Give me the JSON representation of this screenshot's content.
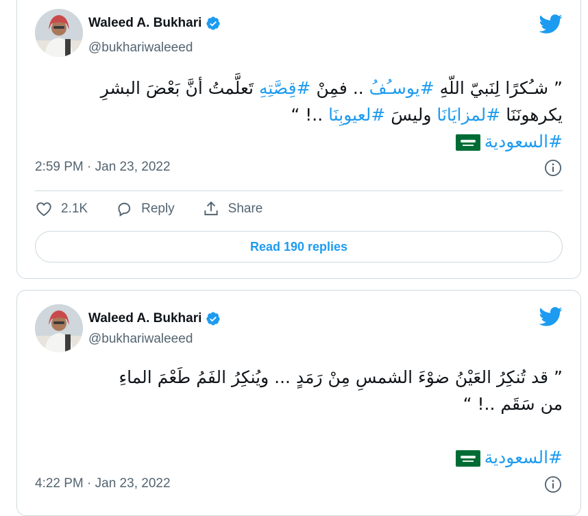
{
  "tweets": [
    {
      "author": {
        "name": "Waleed A. Bukhari",
        "handle": "@bukhariwaleeed"
      },
      "text_lines": [
        [
          {
            "t": "” شـُكرًا لِنَبيّ اللّهِ ",
            "h": false
          },
          {
            "t": "#يوسـُفُ",
            "h": true
          },
          {
            "t": " .. فمِنْ ",
            "h": false
          },
          {
            "t": "#قِصَّتِهِ",
            "h": true
          },
          {
            "t": " تَعلَّمتُ أنَّ بَعْضَ البشرِ",
            "h": false
          }
        ],
        [
          {
            "t": "يكرهونَنَا ",
            "h": false
          },
          {
            "t": "#لمزايَانَا",
            "h": true
          },
          {
            "t": " وليسَ ",
            "h": false
          },
          {
            "t": "#لعيوبِنَا",
            "h": true
          },
          {
            "t": " ..! “",
            "h": false
          }
        ],
        [
          {
            "t": "#السعودية",
            "h": true
          }
        ]
      ],
      "timestamp": "2:59 PM · Jan 23, 2022",
      "likes": "2.1K",
      "reply_label": "Reply",
      "share_label": "Share",
      "read_replies": "Read 190 replies"
    },
    {
      "author": {
        "name": "Waleed A. Bukhari",
        "handle": "@bukhariwaleeed"
      },
      "text_lines": [
        [
          {
            "t": "” قد تُنكِرُ العَيْنُ ضوْءَ الشمسِ مِنْ رَمَدٍ ... ويُنكِرُ الفَمُ طَعْمَ الماءِ",
            "h": false
          }
        ],
        [
          {
            "t": "من سَقَم ..! “",
            "h": false
          }
        ],
        [
          {
            "t": "",
            "h": false
          }
        ],
        [
          {
            "t": "#السعودية",
            "h": true
          }
        ]
      ],
      "timestamp": "4:22 PM · Jan 23, 2022"
    }
  ],
  "colors": {
    "accent": "#1d9bf0",
    "text": "#0f1419",
    "muted": "#536471",
    "border": "#cfd9de",
    "flag": "#006c35"
  },
  "icons": {
    "verified": "verified-badge-icon",
    "logo": "twitter-bird-icon",
    "info": "info-icon",
    "like": "heart-icon",
    "reply": "reply-bubble-icon",
    "share": "share-upload-icon",
    "flag": "saudi-flag-emoji"
  }
}
